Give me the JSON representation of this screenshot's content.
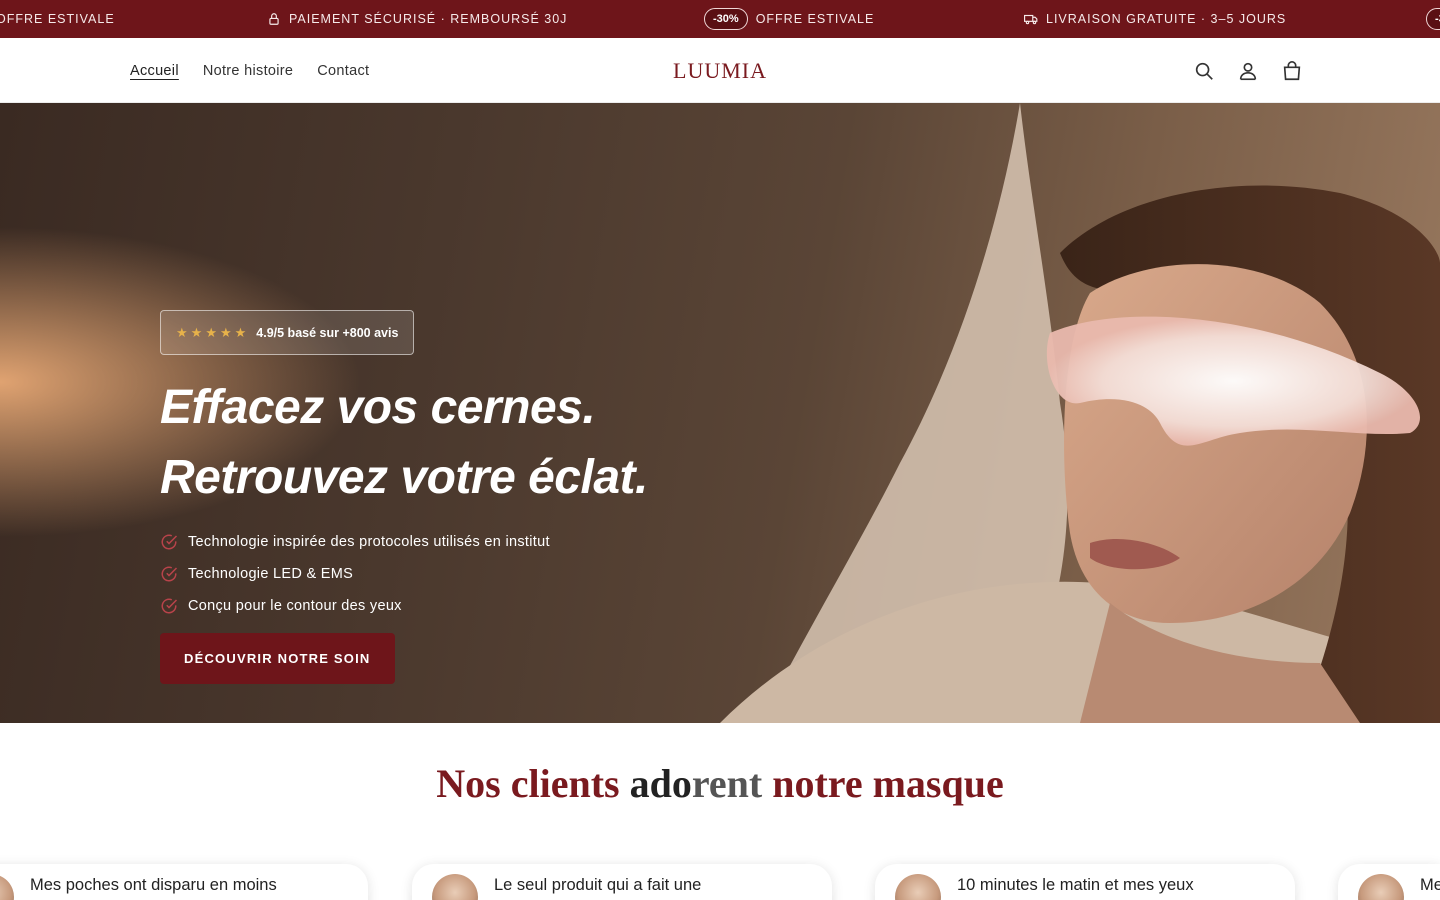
{
  "announcement": {
    "items": [
      {
        "text": "OFFRE ESTIVALE"
      },
      {
        "icon": "lock-icon",
        "text": "PAIEMENT SÉCURISÉ · REMBOURSÉ 30J"
      },
      {
        "badge": "-30%",
        "text": "OFFRE ESTIVALE"
      },
      {
        "icon": "truck-icon",
        "text": "LIVRAISON GRATUITE · 3–5 JOURS"
      }
    ],
    "colors": {
      "background": "#6e151a",
      "text": "#f6eaea"
    }
  },
  "header": {
    "nav": [
      {
        "label": "Accueil",
        "active": true
      },
      {
        "label": "Notre histoire",
        "active": false
      },
      {
        "label": "Contact",
        "active": false
      }
    ],
    "logo": "LUUMIA",
    "icons": [
      "search-icon",
      "account-icon",
      "cart-icon"
    ]
  },
  "hero": {
    "rating": {
      "stars": 5,
      "text": "4.9/5 basé sur +800 avis"
    },
    "title_line1": "Effacez vos cernes.",
    "title_line2": "Retrouvez votre éclat.",
    "bullets": [
      "Technologie inspirée des protocoles utilisés en institut",
      "Technologie LED & EMS",
      "Conçu pour le contour des yeux"
    ],
    "cta_label": "DÉCOUVRIR NOTRE SOIN",
    "accent_color": "#6e151a"
  },
  "reviews": {
    "title_part1": "Nos clients ",
    "title_part2": "ado",
    "title_part3": "rent",
    "title_part4": " notre masque",
    "cards": [
      {
        "text": "Mes poches ont disparu en moins"
      },
      {
        "text": "Le seul produit qui a fait une"
      },
      {
        "text": "10 minutes le matin et mes yeux"
      },
      {
        "text": "Me"
      }
    ]
  }
}
